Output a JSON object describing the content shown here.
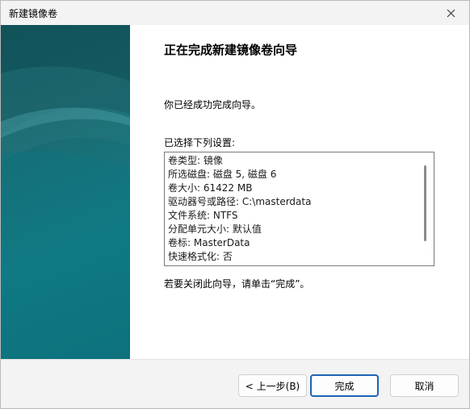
{
  "window": {
    "title": "新建镜像卷"
  },
  "wizard": {
    "heading": "正在完成新建镜像卷向导",
    "success_message": "你已经成功完成向导。",
    "settings_label": "已选择下列设置:",
    "settings": [
      "卷类型: 镜像",
      "所选磁盘: 磁盘 5, 磁盘 6",
      "卷大小: 61422 MB",
      "驱动器号或路径: C:\\masterdata",
      "文件系统: NTFS",
      "分配单元大小: 默认值",
      "卷标: MasterData",
      "快速格式化: 否"
    ],
    "close_hint": "若要关闭此向导，请单击“完成”。"
  },
  "buttons": {
    "back": "< 上一步(B)",
    "finish": "完成",
    "cancel": "取消"
  },
  "colors": {
    "accent": "#1d62b4",
    "side_panel": "#137c86"
  },
  "icons": {
    "close": "close-icon"
  }
}
